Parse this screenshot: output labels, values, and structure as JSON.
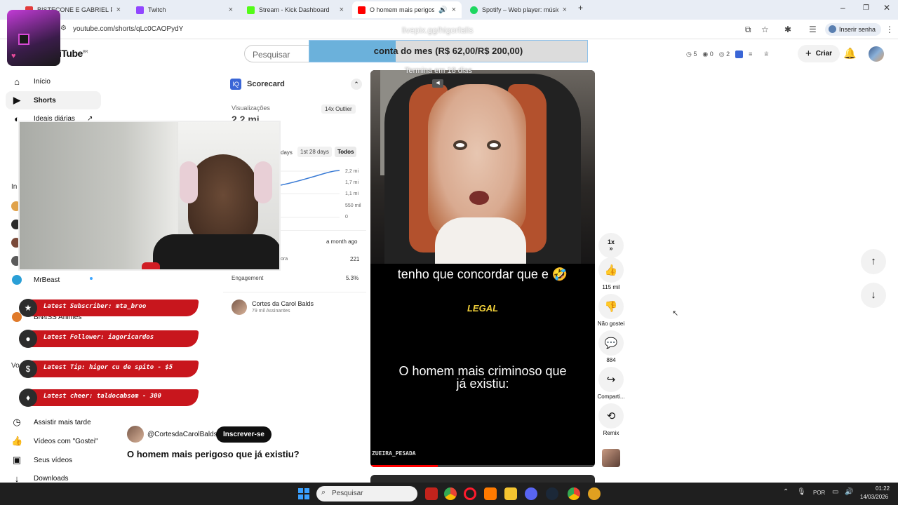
{
  "browser": {
    "tabs": [
      {
        "title": "BISTECONE E GABRIEL PLANEJ...",
        "color": "#e23b3b",
        "active": false
      },
      {
        "title": "Twitch",
        "color": "#9146ff",
        "active": false
      },
      {
        "title": "Stream - Kick Dashboard",
        "color": "#53fc18",
        "active": false
      },
      {
        "title": "O homem mais perigoso q",
        "color": "#ff0000",
        "active": true
      },
      {
        "title": "Spotify – Web player: música p...",
        "color": "#1ed760",
        "active": false
      }
    ],
    "url": "youtube.com/shorts/qLc0CAOPydY",
    "signin_label": "Inserir senha"
  },
  "header": {
    "logo_text": "iTube",
    "logo_region": "BR",
    "search_placeholder": "Pesquisar",
    "stats": [
      "5",
      "0",
      "2"
    ],
    "create_label": "Criar"
  },
  "sidebar": {
    "items": [
      {
        "label": "Início",
        "icon": "home-icon"
      },
      {
        "label": "Shorts",
        "icon": "shorts-icon"
      },
      {
        "label": "Ideais diárias",
        "icon": "ideas-icon"
      },
      {
        "label": "MrBeast",
        "icon": "channel-icon"
      },
      {
        "label": "BN4SS Animes",
        "icon": "channel-icon"
      },
      {
        "label": "Assistir mais tarde",
        "icon": "clock-icon"
      },
      {
        "label": "Vídeos com \"Gostei\"",
        "icon": "thumb-up-icon"
      },
      {
        "label": "Seus vídeos",
        "icon": "play-icon"
      },
      {
        "label": "Downloads",
        "icon": "download-icon"
      }
    ]
  },
  "scorecard": {
    "title": "Scorecard",
    "views_label": "Visualizações",
    "views_value": "2,2 mi",
    "outlier_badge": "14x Outlier",
    "ranges": [
      "days",
      "1st 28 days",
      "Todos"
    ],
    "axis_ticks": [
      "2,2 mi",
      "1,7 mi",
      "1,1 mi",
      "550 mil",
      "0"
    ],
    "published": "a month ago",
    "row_label": "ora",
    "row_value": "221",
    "engagement_label": "Engagement",
    "engagement_value": "5.3%",
    "channel_name": "Cortes da Carol Balds",
    "channel_subs": "79 mil Assinantes"
  },
  "video": {
    "caption1": "tenho que concordar que e 🤣",
    "caption2": "LEGAL",
    "caption3": "O homem mais criminoso que já existiu:",
    "watermark": "ZUEIRA_PESADA",
    "channel_handle": "@CortesdaCarolBalds",
    "subscribe_label": "Inscrever-se",
    "title": "O homem mais perigoso que já existiu?"
  },
  "actions": {
    "speed": "1x",
    "likes": "115 mil",
    "dislike": "Não gostei",
    "comments": "884",
    "share": "Comparti...",
    "remix": "Remix"
  },
  "overlay": {
    "pix_text": "livepix.gg/higorfalls",
    "goal_text": "conta do mes (R$ 62,00/R$ 200,00)",
    "goal_progress": 0.31,
    "goal_ends": "Termina em 18 dias",
    "alerts": [
      {
        "icon": "star-icon",
        "text": "Latest Subscriber: mta_broo"
      },
      {
        "icon": "person-icon",
        "text": "Latest Follower: iagoricardos"
      },
      {
        "icon": "dollar-icon",
        "text": "Latest Tip: higor cu de spito - $5"
      },
      {
        "icon": "diamond-icon",
        "text": "Latest cheer: taldocabsom - 300"
      }
    ]
  },
  "taskbar": {
    "search_placeholder": "Pesquisar",
    "lang": "POR",
    "time": "01:22",
    "date": "14/03/2026"
  }
}
